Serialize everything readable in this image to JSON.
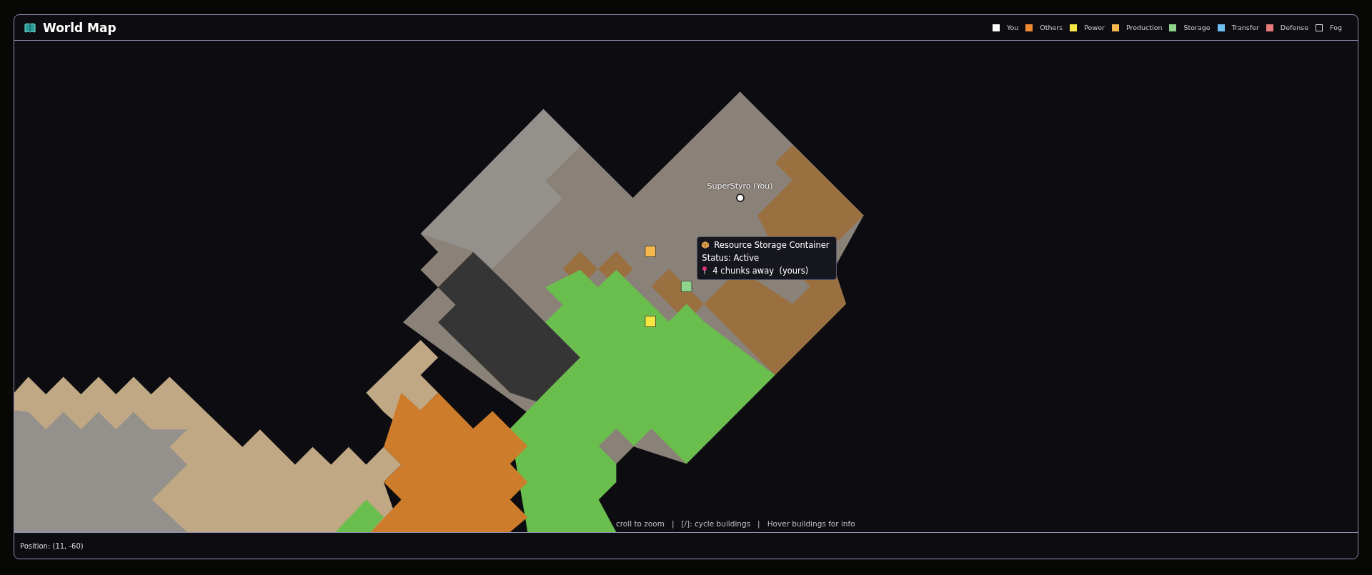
{
  "window": {
    "title": "World Map"
  },
  "legend": [
    {
      "label": "You",
      "color": "#ffffff",
      "kind": "fill"
    },
    {
      "label": "Others",
      "color": "#f08a30",
      "kind": "fill"
    },
    {
      "label": "Power",
      "color": "#f5e642",
      "kind": "fill"
    },
    {
      "label": "Production",
      "color": "#f5b74e",
      "kind": "fill"
    },
    {
      "label": "Storage",
      "color": "#8fd48a",
      "kind": "fill"
    },
    {
      "label": "Transfer",
      "color": "#6ec1f0",
      "kind": "fill"
    },
    {
      "label": "Defense",
      "color": "#e87a7a",
      "kind": "fill"
    },
    {
      "label": "Fog",
      "color": "#0c0c10",
      "kind": "outline"
    }
  ],
  "map": {
    "player": {
      "label": "SuperStyro (You)"
    },
    "buildings": [
      {
        "color": "#f5b74e"
      },
      {
        "color": "#8fd48a"
      },
      {
        "color": "#f5e642"
      }
    ],
    "tooltip": {
      "title": "Resource Storage Container",
      "status": "Status: Active",
      "distance": "4 chunks away  (yours)"
    },
    "hint": "croll to zoom   |   [/]: cycle buildings   |   Hover buildings for info"
  },
  "status_bar": {
    "position": "Position: (11, -60)"
  }
}
